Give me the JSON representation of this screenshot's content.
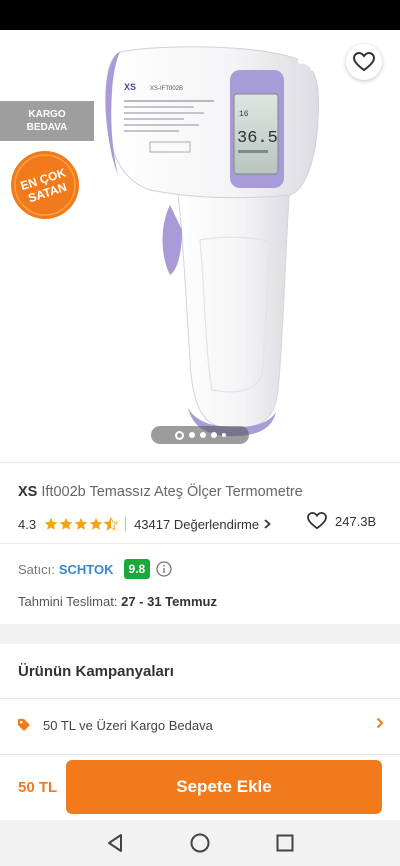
{
  "hero": {
    "kargo_badge_line1": "KARGO",
    "kargo_badge_line2": "BEDAVA",
    "encok_line1": "EN ÇOK",
    "encok_line2": "SATAN",
    "device_brand": "XS",
    "device_model": "XS-IFT002B",
    "device_reading": "36.5",
    "gallery_page": 1,
    "gallery_count": 5
  },
  "product": {
    "brand": "XS",
    "name": "Ift002b Temassız Ateş Ölçer Termometre",
    "rating": "4.3",
    "rating_value": 4.3,
    "review_count": "43417 Değerlendirme",
    "likes": "247.3B"
  },
  "seller": {
    "label": "Satıcı:",
    "name": "SCHTOK",
    "score": "9.8"
  },
  "delivery": {
    "label": "Tahmini Teslimat:",
    "dates": "27 - 31 Temmuz"
  },
  "campaigns": {
    "title": "Ürünün Kampanyaları",
    "items": [
      {
        "label": "50 TL ve Üzeri Kargo Bedava"
      }
    ]
  },
  "cart": {
    "price": "50 TL",
    "button_label": "Sepete Ekle"
  },
  "colors": {
    "accent": "#f27a1a",
    "seller_link": "#3c86c9",
    "score_green": "#1ba83a",
    "star": "#f2a316",
    "device_purple": "#a89bd8"
  },
  "icons": {
    "back": "arrow-left-icon",
    "share": "share-icon",
    "favorite": "heart-icon",
    "info": "info-circle-icon",
    "tag": "tag-icon",
    "chevron": "chevron-right-icon",
    "nav_back": "triangle-back-icon",
    "nav_home": "circle-home-icon",
    "nav_recent": "square-recent-icon"
  }
}
